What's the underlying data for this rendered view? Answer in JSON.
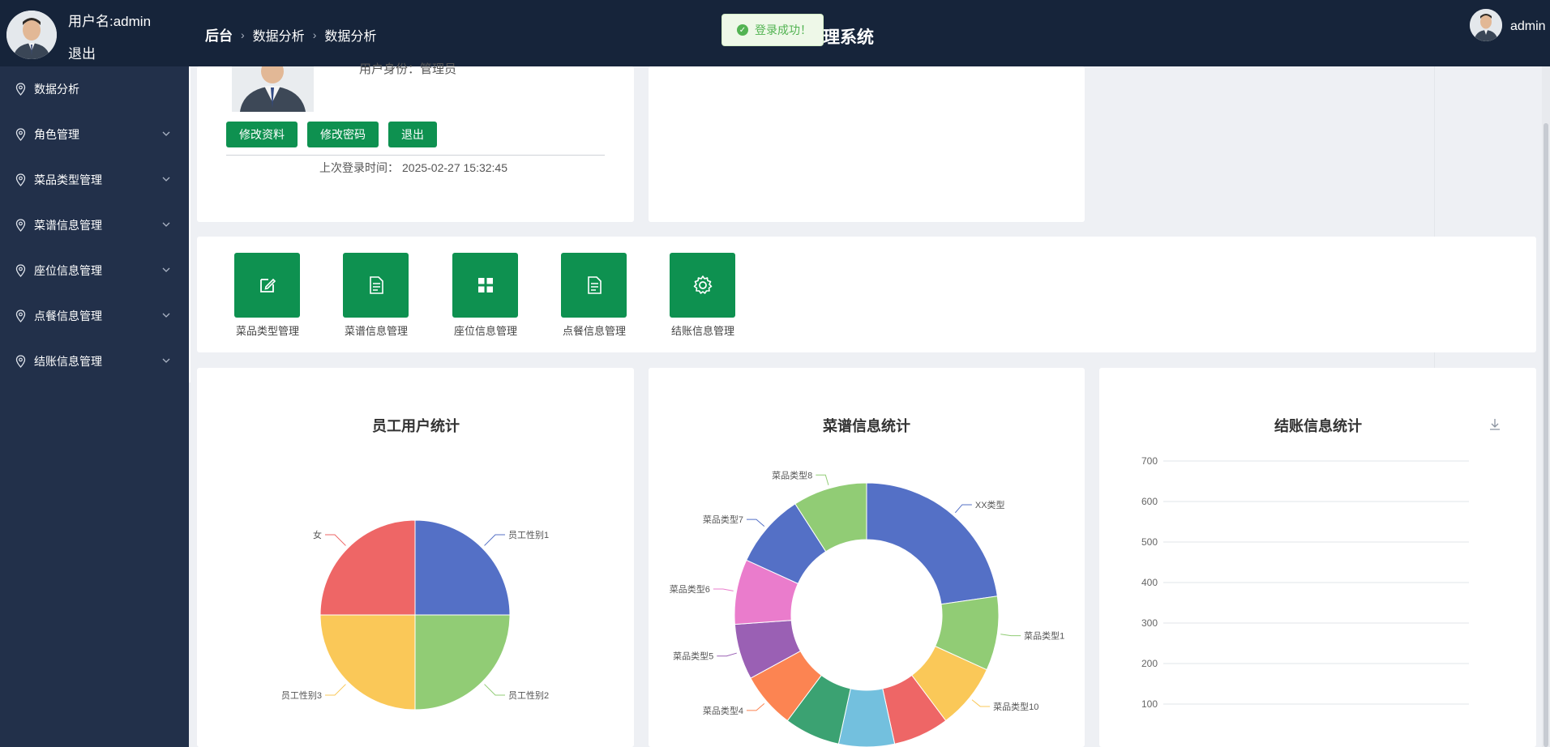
{
  "header": {
    "username": "用户名:admin",
    "logout": "退出",
    "breadcrumb": [
      "后台",
      "数据分析",
      "数据分析"
    ],
    "system_title": "理系统",
    "toast": "登录成功！",
    "right_user": "admin"
  },
  "sidebar": {
    "items": [
      {
        "label": "数据分析",
        "icon": "location-pin-icon",
        "expandable": false
      },
      {
        "label": "角色管理",
        "icon": "location-pin-icon",
        "expandable": true
      },
      {
        "label": "菜品类型管理",
        "icon": "location-pin-icon",
        "expandable": true
      },
      {
        "label": "菜谱信息管理",
        "icon": "location-pin-icon",
        "expandable": true
      },
      {
        "label": "座位信息管理",
        "icon": "location-pin-icon",
        "expandable": true
      },
      {
        "label": "点餐信息管理",
        "icon": "location-pin-icon",
        "expandable": true
      },
      {
        "label": "结账信息管理",
        "icon": "location-pin-icon",
        "expandable": true
      }
    ]
  },
  "profile": {
    "role_text": "用户身份：管理员",
    "buttons": [
      "修改资料",
      "修改密码",
      "退出"
    ],
    "last_login_label": "上次登录时间：",
    "last_login_value": "2025-02-27 15:32:45"
  },
  "quick_links": [
    {
      "label": "菜品类型管理",
      "icon": "edit-icon"
    },
    {
      "label": "菜谱信息管理",
      "icon": "document-icon"
    },
    {
      "label": "座位信息管理",
      "icon": "grid-icon"
    },
    {
      "label": "点餐信息管理",
      "icon": "document-icon"
    },
    {
      "label": "结账信息管理",
      "icon": "gear-icon"
    }
  ],
  "colors": {
    "accent": "#0e9150",
    "header_bg": "#16243a",
    "sidebar_bg": "#22304a"
  },
  "chart_data": [
    {
      "type": "pie",
      "title": "员工用户统计",
      "slices": [
        {
          "label": "员工性别1",
          "value": 1,
          "color": "#5470c6"
        },
        {
          "label": "员工性别2",
          "value": 1,
          "color": "#91cc75"
        },
        {
          "label": "员工性别3",
          "value": 1,
          "color": "#fac858"
        },
        {
          "label": "女",
          "value": 1,
          "color": "#ee6666"
        }
      ]
    },
    {
      "type": "pie",
      "subtype": "donut",
      "title": "菜谱信息统计",
      "slices": [
        {
          "label": "XX类型",
          "value": 20,
          "color": "#5470c6"
        },
        {
          "label": "菜品类型1",
          "value": 8,
          "color": "#91cc75"
        },
        {
          "label": "菜品类型10",
          "value": 7,
          "color": "#fac858"
        },
        {
          "label": "",
          "value": 6,
          "color": "#ee6666"
        },
        {
          "label": "",
          "value": 6,
          "color": "#73c0de"
        },
        {
          "label": "",
          "value": 6,
          "color": "#3ba272"
        },
        {
          "label": "菜品类型4",
          "value": 6,
          "color": "#fc8452"
        },
        {
          "label": "菜品类型5",
          "value": 6,
          "color": "#9a60b4"
        },
        {
          "label": "菜品类型6",
          "value": 7,
          "color": "#ea7ccc"
        },
        {
          "label": "菜品类型7",
          "value": 8,
          "color": "#5470c6"
        },
        {
          "label": "菜品类型8",
          "value": 8,
          "color": "#91cc75"
        }
      ]
    },
    {
      "type": "bar",
      "title": "结账信息统计",
      "y_ticks": [
        700,
        600,
        500,
        400,
        300,
        200,
        100
      ],
      "categories": [],
      "values": [],
      "has_download_icon": true
    }
  ]
}
